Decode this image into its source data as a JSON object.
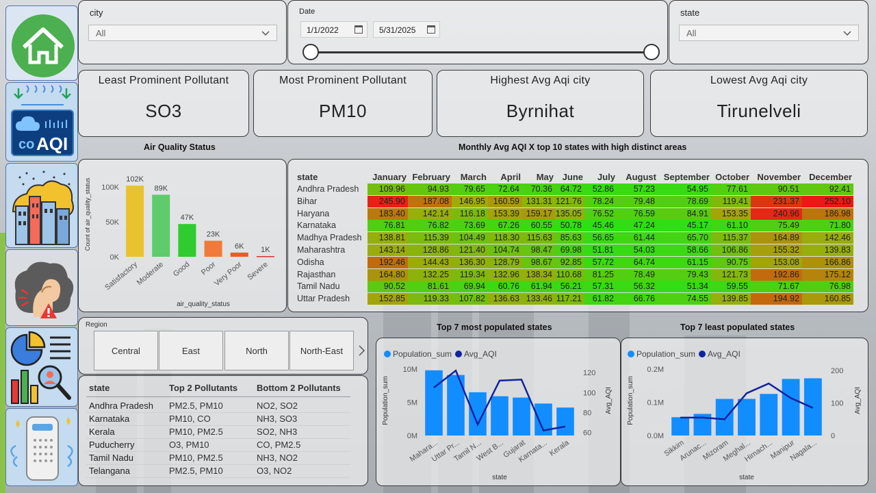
{
  "filters": {
    "city": {
      "label": "city",
      "value": "All"
    },
    "date": {
      "label": "Date",
      "start": "1/1/2022",
      "end": "5/31/2025"
    },
    "state": {
      "label": "state",
      "value": "All"
    }
  },
  "kpis": [
    {
      "label": "Least Prominent Pollutant",
      "value": "SO3"
    },
    {
      "label": "Most Prominent Pollutant",
      "value": "PM10"
    },
    {
      "label": "Highest Avg Aqi city",
      "value": "Byrnihat"
    },
    {
      "label": "Lowest Avg Aqi city",
      "value": "Tirunelveli"
    }
  ],
  "titles": {
    "air_quality": "Air Quality Status",
    "matrix": "Monthly Avg AQI X top 10 states with high distinct areas",
    "top_pop": "Top 7 most populated states",
    "least_pop": "Top 7 least populated states"
  },
  "matrix": {
    "state_header": "state",
    "months": [
      "January",
      "February",
      "March",
      "April",
      "May",
      "June",
      "July",
      "August",
      "September",
      "October",
      "November",
      "December"
    ],
    "rows": [
      {
        "state": "Andhra Pradesh",
        "values": [
          "109.96",
          "94.93",
          "79.65",
          "72.64",
          "70.36",
          "64.72",
          "52.86",
          "57.23",
          "54.95",
          "77.61",
          "90.51",
          "92.41"
        ]
      },
      {
        "state": "Bihar",
        "values": [
          "245.90",
          "187.08",
          "146.95",
          "160.59",
          "131.31",
          "121.76",
          "78.24",
          "79.48",
          "78.69",
          "119.41",
          "231.37",
          "252.10"
        ]
      },
      {
        "state": "Haryana",
        "values": [
          "183.40",
          "142.14",
          "116.18",
          "153.39",
          "159.17",
          "135.05",
          "76.52",
          "76.59",
          "84.91",
          "153.35",
          "240.96",
          "186.98"
        ]
      },
      {
        "state": "Karnataka",
        "values": [
          "76.81",
          "76.82",
          "73.69",
          "67.26",
          "60.55",
          "50.78",
          "45.46",
          "47.24",
          "45.17",
          "61.10",
          "75.49",
          "71.80"
        ]
      },
      {
        "state": "Madhya Pradesh",
        "values": [
          "138.81",
          "115.39",
          "104.49",
          "118.30",
          "115.63",
          "85.63",
          "56.65",
          "61.44",
          "65.70",
          "115.37",
          "164.89",
          "142.46"
        ]
      },
      {
        "state": "Maharashtra",
        "values": [
          "143.14",
          "128.86",
          "121.40",
          "104.74",
          "98.47",
          "69.98",
          "51.81",
          "54.03",
          "58.66",
          "106.86",
          "155.32",
          "139.83"
        ]
      },
      {
        "state": "Odisha",
        "values": [
          "192.46",
          "144.43",
          "136.30",
          "128.79",
          "98.67",
          "92.85",
          "57.72",
          "64.74",
          "61.15",
          "90.75",
          "153.08",
          "166.86"
        ]
      },
      {
        "state": "Rajasthan",
        "values": [
          "164.80",
          "132.25",
          "119.34",
          "132.96",
          "138.34",
          "110.68",
          "81.25",
          "78.49",
          "79.43",
          "121.73",
          "192.86",
          "175.12"
        ]
      },
      {
        "state": "Tamil Nadu",
        "values": [
          "90.52",
          "81.61",
          "69.94",
          "60.76",
          "61.94",
          "56.21",
          "57.31",
          "56.32",
          "51.34",
          "59.55",
          "71.67",
          "76.98"
        ]
      },
      {
        "state": "Uttar Pradesh",
        "values": [
          "152.85",
          "119.33",
          "107.82",
          "136.63",
          "133.46",
          "117.21",
          "61.82",
          "66.76",
          "74.55",
          "139.85",
          "194.92",
          "160.85"
        ]
      }
    ]
  },
  "region": {
    "label": "Region",
    "tiles": [
      "Central",
      "East",
      "North",
      "North-East"
    ]
  },
  "pollutants": {
    "headers": [
      "state",
      "Top 2 Pollutants",
      "Bottom 2 Pollutants"
    ],
    "rows": [
      [
        "Andhra Pradesh",
        "PM2.5, PM10",
        "NO2, SO2"
      ],
      [
        "Karnataka",
        "PM10, CO",
        "NH3, SO3"
      ],
      [
        "Kerala",
        "PM10, PM2.5",
        "SO2, NH3"
      ],
      [
        "Puducherry",
        "O3, PM10",
        "CO, PM2.5"
      ],
      [
        "Tamil Nadu",
        "PM10, PM2.5",
        "NH3, NO2"
      ],
      [
        "Telangana",
        "PM2.5, PM10",
        "O3, NO2"
      ]
    ]
  },
  "colors": {
    "bar_blue": "#118dff",
    "line_navy": "#12239e",
    "home_green": "#4caf50"
  },
  "chart_data": [
    {
      "type": "bar",
      "title": "Air Quality Status",
      "xlabel": "air_quality_status",
      "ylabel": "Count of air_quality_status",
      "categories": [
        "Satisfactory",
        "Moderate",
        "Good",
        "Poor",
        "Very Poor",
        "Severe"
      ],
      "values": [
        102000,
        89000,
        47000,
        23000,
        6000,
        1000
      ],
      "data_labels": [
        "102K",
        "89K",
        "47K",
        "23K",
        "6K",
        "1K"
      ],
      "colors": [
        "#e8c32e",
        "#5ecc6b",
        "#2ecc2e",
        "#f07a3a",
        "#e0602a",
        "#d83030"
      ],
      "yticks": [
        "0K",
        "50K",
        "100K"
      ],
      "ylim": [
        0,
        110000
      ]
    },
    {
      "type": "bar",
      "title": "Top 7 most populated states",
      "xlabel": "state",
      "ylabel": "Population_sum",
      "y2label": "Avg_AQI",
      "legend": [
        "Population_sum",
        "Avg_AQI"
      ],
      "categories": [
        "Mahara...",
        "Uttar Pr...",
        "Tamil N...",
        "West B...",
        "Gujarat",
        "Karnata...",
        "Kerala"
      ],
      "series": [
        {
          "name": "Population_sum",
          "values": [
            9.8,
            9.1,
            6.5,
            5.9,
            5.7,
            4.8,
            4.2
          ]
        },
        {
          "name": "Avg_AQI",
          "values": [
            105,
            122,
            68,
            112,
            113,
            62,
            66
          ]
        }
      ],
      "yticks": [
        "0M",
        "5M",
        "10M"
      ],
      "y2ticks": [
        "60",
        "80",
        "100",
        "120"
      ],
      "ylim": [
        0,
        10.5
      ],
      "y2lim": [
        57,
        127
      ]
    },
    {
      "type": "bar",
      "title": "Top 7 least populated states",
      "xlabel": "state",
      "ylabel": "Population_sum",
      "y2label": "Avg_AQI",
      "legend": [
        "Population_sum",
        "Avg_AQI"
      ],
      "categories": [
        "Sikkim",
        "Arunac...",
        "Mizoram",
        "Meghal...",
        "Himach...",
        "Manipur",
        "Nagala..."
      ],
      "series": [
        {
          "name": "Population_sum",
          "values": [
            0.055,
            0.065,
            0.11,
            0.11,
            0.125,
            0.17,
            0.172
          ]
        },
        {
          "name": "Avg_AQI",
          "values": [
            55,
            55,
            50,
            130,
            160,
            115,
            85
          ]
        }
      ],
      "yticks": [
        "0.0M",
        "0.1M",
        "0.2M"
      ],
      "y2ticks": [
        "0",
        "100",
        "200"
      ],
      "ylim": [
        0,
        0.21
      ],
      "y2lim": [
        0,
        215
      ]
    }
  ]
}
